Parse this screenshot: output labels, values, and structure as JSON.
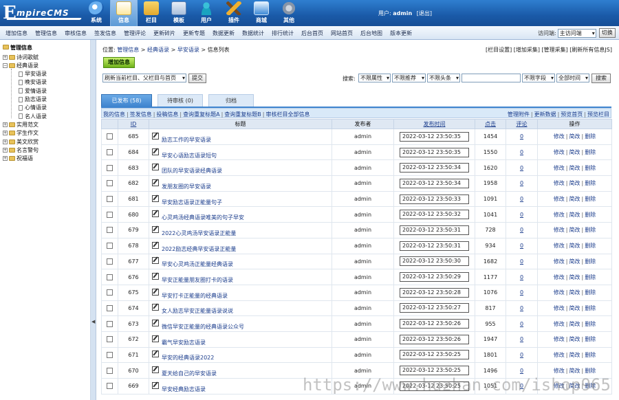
{
  "logo": {
    "first": "E",
    "rest": "mpireCMS"
  },
  "topnav": [
    {
      "label": "系统",
      "icon": "system-globe-icon"
    },
    {
      "label": "信息",
      "icon": "info-notepad-icon",
      "active": true
    },
    {
      "label": "栏目",
      "icon": "column-folder-icon"
    },
    {
      "label": "模板",
      "icon": "template-window-icon"
    },
    {
      "label": "用户",
      "icon": "user-icon"
    },
    {
      "label": "插件",
      "icon": "plugin-tools-icon"
    },
    {
      "label": "商城",
      "icon": "shop-icon"
    },
    {
      "label": "其他",
      "icon": "gear-icon"
    }
  ],
  "user": {
    "prefix": "用户:",
    "name": "admin",
    "logout": "[退出]"
  },
  "menu": [
    "增加信息",
    "管理信息",
    "审核信息",
    "签发信息",
    "管理评论",
    "更新碎片",
    "更新专题",
    "数据更新",
    "数据统计",
    "排行统计",
    "后台首页",
    "网站首页",
    "后台地图",
    "版本更新"
  ],
  "quick": {
    "label": "访问端:",
    "value": "主访问端",
    "button": "切换"
  },
  "tree": {
    "title": "管理信息",
    "nodes": [
      {
        "label": "诗词歌赋",
        "type": "folder",
        "toggle": "+"
      },
      {
        "label": "经典语录",
        "type": "folder",
        "toggle": "−"
      },
      {
        "label": "早安语录",
        "type": "page"
      },
      {
        "label": "晚安语录",
        "type": "page"
      },
      {
        "label": "爱情语录",
        "type": "page"
      },
      {
        "label": "励志语录",
        "type": "page"
      },
      {
        "label": "心情语录",
        "type": "page"
      },
      {
        "label": "名人语录",
        "type": "page"
      },
      {
        "label": "实用范文",
        "type": "folder",
        "toggle": "+"
      },
      {
        "label": "学生作文",
        "type": "folder",
        "toggle": "+"
      },
      {
        "label": "美文欣赏",
        "type": "folder",
        "toggle": "+"
      },
      {
        "label": "名言警句",
        "type": "folder",
        "toggle": "+"
      },
      {
        "label": "祝福语",
        "type": "folder",
        "toggle": "+"
      }
    ]
  },
  "breadcrumb": {
    "prefix": "位置:",
    "items": [
      "管理信息",
      "经典语录",
      "早安语录",
      "信息列表"
    ],
    "sep": " > "
  },
  "toplinks": "[栏目设置] [增加采集] [管理采集] [刷新所有信息JS]",
  "add_button": "增加信息",
  "refresh_select": "刷新当前栏目、父栏目与首页",
  "submit_button": "提交",
  "search": {
    "label": "搜索:",
    "attr": "不限属性",
    "recommend": "不限推荐",
    "headline": "不限头条",
    "field": "不限字段",
    "time": "全部时间",
    "button": "搜索"
  },
  "tabs": [
    {
      "label": "已发布 (58)",
      "active": true
    },
    {
      "label": "待审核 (0)"
    },
    {
      "label": "归档"
    }
  ],
  "sublinks_left": [
    "我的信息",
    "签发信息",
    "投稿信息",
    "查询重复标题A",
    "查询重复标题B",
    "审核栏目全部信息"
  ],
  "sublinks_right": [
    "管理附件",
    "更新数据",
    "预览首页",
    "预览栏目"
  ],
  "columns": {
    "id": "ID",
    "title": "标题",
    "author": "发布者",
    "time": "发布时间",
    "clicks": "点击",
    "comments": "评论",
    "ops": "操作"
  },
  "ops_labels": [
    "修改",
    "简改",
    "删除"
  ],
  "rows": [
    {
      "id": "685",
      "title": "励志工作的早安语录",
      "author": "admin",
      "time": "2022-03-12 23:50:35",
      "clicks": "1454",
      "comments": "0"
    },
    {
      "id": "684",
      "title": "早安心语励志语录短句",
      "author": "admin",
      "time": "2022-03-12 23:50:35",
      "clicks": "1550",
      "comments": "0"
    },
    {
      "id": "683",
      "title": "团队的早安语录经典语录",
      "author": "admin",
      "time": "2022-03-12 23:50:34",
      "clicks": "1620",
      "comments": "0"
    },
    {
      "id": "682",
      "title": "发朋友圈的早安语录",
      "author": "admin",
      "time": "2022-03-12 23:50:34",
      "clicks": "1958",
      "comments": "0"
    },
    {
      "id": "681",
      "title": "早安励志语录正能量句子",
      "author": "admin",
      "time": "2022-03-12 23:50:33",
      "clicks": "1091",
      "comments": "0"
    },
    {
      "id": "680",
      "title": "心灵鸡汤经典语录唯美的句子早安",
      "author": "admin",
      "time": "2022-03-12 23:50:32",
      "clicks": "1041",
      "comments": "0"
    },
    {
      "id": "679",
      "title": "2022心灵鸡汤早安语录正能量",
      "author": "admin",
      "time": "2022-03-12 23:50:31",
      "clicks": "728",
      "comments": "0"
    },
    {
      "id": "678",
      "title": "2022励志经典早安语录正能量",
      "author": "admin",
      "time": "2022-03-12 23:50:31",
      "clicks": "934",
      "comments": "0"
    },
    {
      "id": "677",
      "title": "早安心灵鸡汤正能量经典语录",
      "author": "admin",
      "time": "2022-03-12 23:50:30",
      "clicks": "1682",
      "comments": "0"
    },
    {
      "id": "676",
      "title": "早安正能量朋友圈打卡的语录",
      "author": "admin",
      "time": "2022-03-12 23:50:29",
      "clicks": "1177",
      "comments": "0"
    },
    {
      "id": "675",
      "title": "早安打卡正能量的经典语录",
      "author": "admin",
      "time": "2022-03-12 23:50:28",
      "clicks": "1076",
      "comments": "0"
    },
    {
      "id": "674",
      "title": "女人励志早安正能量语录说说",
      "author": "admin",
      "time": "2022-03-12 23:50:27",
      "clicks": "817",
      "comments": "0"
    },
    {
      "id": "673",
      "title": "微信早安正能量的经典语录公众号",
      "author": "admin",
      "time": "2022-03-12 23:50:26",
      "clicks": "955",
      "comments": "0"
    },
    {
      "id": "672",
      "title": "霸气早安励志语录",
      "author": "admin",
      "time": "2022-03-12 23:50:26",
      "clicks": "1947",
      "comments": "0"
    },
    {
      "id": "671",
      "title": "早安的经典语录2022",
      "author": "admin",
      "time": "2022-03-12 23:50:25",
      "clicks": "1801",
      "comments": "0"
    },
    {
      "id": "670",
      "title": "夏天给自己的早安语录",
      "author": "admin",
      "time": "2022-03-12 23:50:25",
      "clicks": "1496",
      "comments": "0"
    },
    {
      "id": "669",
      "title": "早安经典励志语录",
      "author": "admin",
      "time": "2022-03-12 23:50:25",
      "clicks": "1051",
      "comments": "0"
    }
  ],
  "watermark": "https://www.huzhan.com/ishop965"
}
